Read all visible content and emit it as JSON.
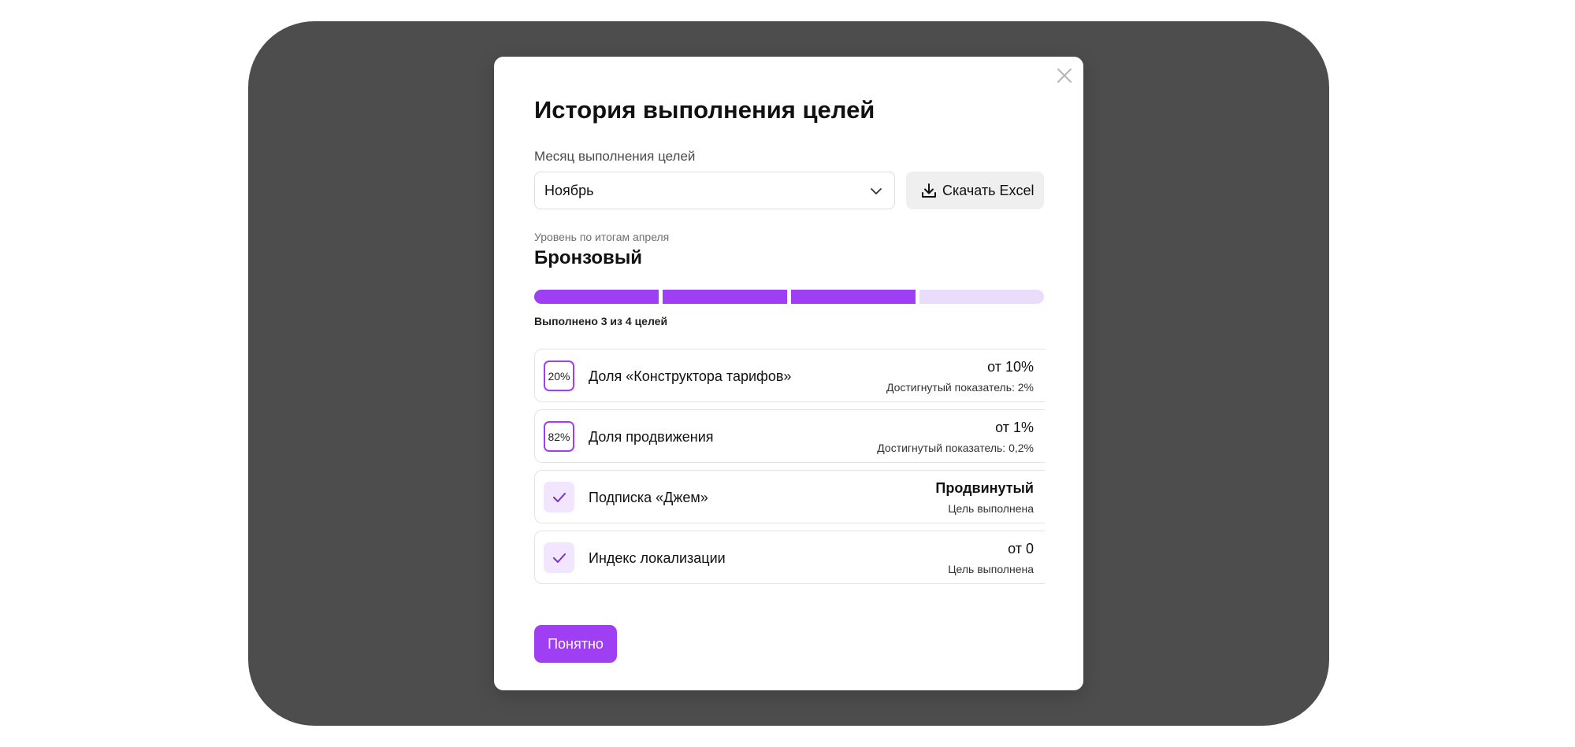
{
  "modal": {
    "title": "История выполнения целей",
    "month_label": "Месяц выполнения целей",
    "month_value": "Ноябрь",
    "excel_button": "Скачать Excel",
    "level_caption": "Уровень по итогам апреля",
    "level_name": "Бронзовый",
    "progress": {
      "completed": 3,
      "total": 4,
      "text": "Выполнено 3 из 4 целей"
    },
    "goals": [
      {
        "badge": "20%",
        "status": "in-progress",
        "name": "Доля «Конструктора тарифов»",
        "target": "от 10%",
        "sub": "Достигнутый показатель: 2%"
      },
      {
        "badge": "82%",
        "status": "in-progress",
        "name": "Доля продвижения",
        "target": "от 1%",
        "sub": "Достигнутый показатель: 0,2%"
      },
      {
        "badge": "check-icon",
        "status": "done",
        "name": "Подписка «Джем»",
        "target": "Продвинутый",
        "sub": "Цель выполнена"
      },
      {
        "badge": "check-icon",
        "status": "done",
        "name": "Индекс локализации",
        "target": "от 0",
        "sub": "Цель выполнена"
      }
    ],
    "ok_button": "Понятно"
  },
  "colors": {
    "accent": "#9f3ff4",
    "accent_light": "#eadcfb",
    "backdrop": "#4d4d4d"
  }
}
